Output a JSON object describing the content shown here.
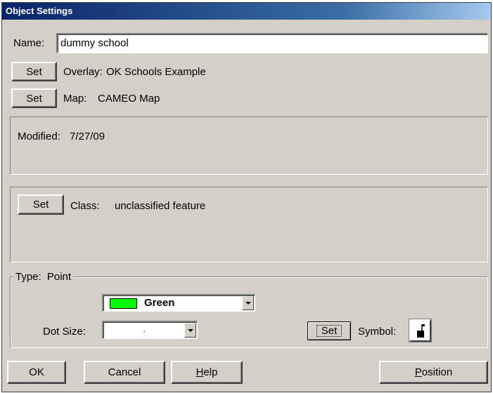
{
  "window": {
    "title": "Object Settings"
  },
  "name_row": {
    "label": "Name:",
    "value": "dummy school"
  },
  "overlay_row": {
    "button": "Set",
    "label": "Overlay:",
    "value": "OK Schools Example"
  },
  "map_row": {
    "button": "Set",
    "label": "Map:",
    "value": "CAMEO Map"
  },
  "modified": {
    "label": "Modified:",
    "value": "7/27/09"
  },
  "class_row": {
    "button": "Set",
    "label": "Class:",
    "value": "unclassified feature"
  },
  "type_group": {
    "label": "Type:",
    "value": "Point",
    "color_select": {
      "value": "Green",
      "swatch": "#00ff00"
    },
    "dot_size": {
      "label": "Dot Size:",
      "value": "."
    },
    "symbol": {
      "button": "Set",
      "label": "Symbol:"
    }
  },
  "footer": {
    "ok": "OK",
    "cancel": "Cancel",
    "help_underline": "H",
    "help_rest": "elp",
    "position_underline": "P",
    "position_rest": "osition"
  }
}
